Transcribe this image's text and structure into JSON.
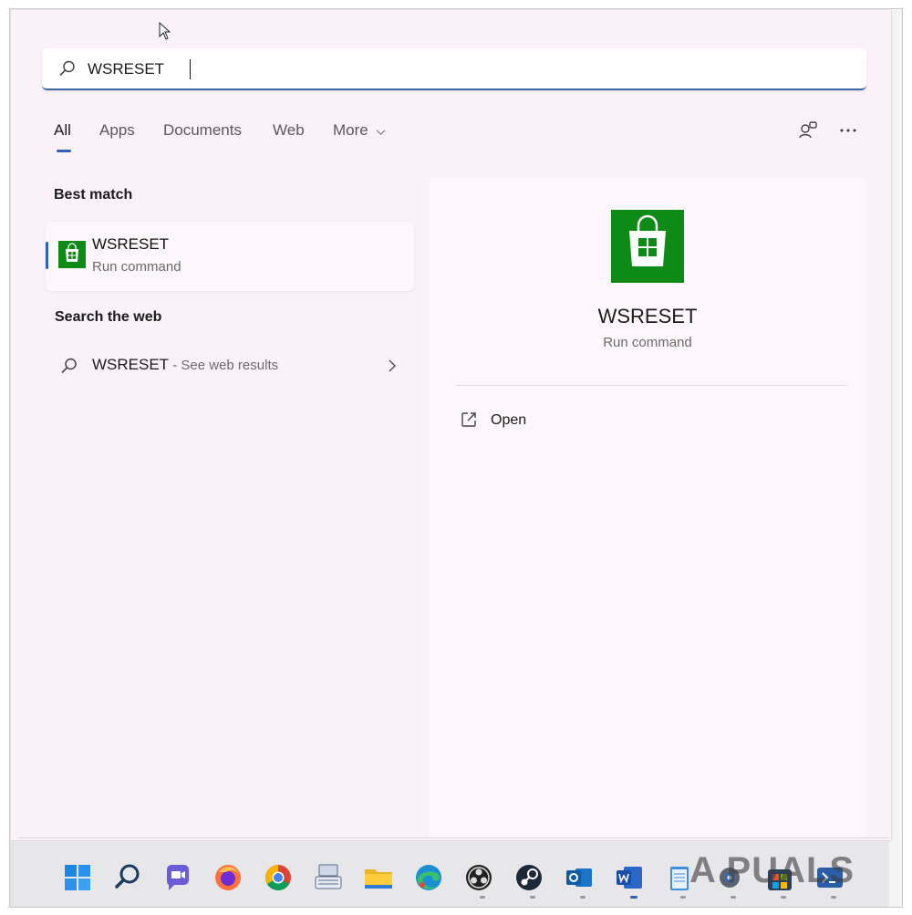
{
  "search": {
    "value": "WSRESET"
  },
  "tabs": [
    {
      "label": "All"
    },
    {
      "label": "Apps"
    },
    {
      "label": "Documents"
    },
    {
      "label": "Web"
    },
    {
      "label": "More"
    }
  ],
  "best_match": {
    "heading": "Best match",
    "title": "WSRESET",
    "subtitle": "Run command"
  },
  "search_web": {
    "heading": "Search the web",
    "query": "WSRESET",
    "suffix": " - See web results"
  },
  "detail": {
    "title": "WSRESET",
    "subtitle": "Run command",
    "open_label": "Open"
  },
  "taskbar": {
    "icons": [
      "windows-start-icon",
      "search-icon",
      "chat-icon",
      "firefox-icon",
      "chrome-icon",
      "keyboard-app-icon",
      "file-explorer-icon",
      "edge-icon",
      "obs-icon",
      "steam-icon",
      "outlook-icon",
      "word-icon",
      "notepad-icon",
      "settings-icon",
      "store-icon",
      "terminal-icon"
    ]
  },
  "watermark": {
    "text": "A PUALS"
  },
  "colors": {
    "accent": "#2f62b3",
    "store_green": "#0e8a16",
    "panel_bg": "#fbf1f8"
  }
}
